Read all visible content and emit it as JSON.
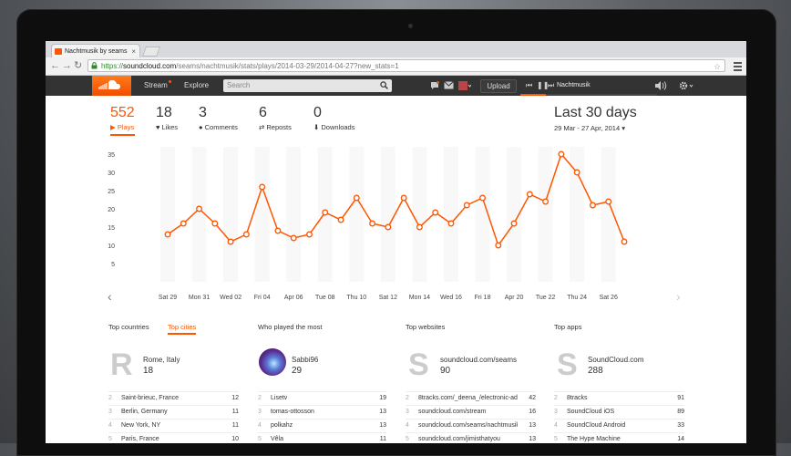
{
  "browser": {
    "tab_title": "Nachtmusik by seams",
    "url_scheme": "https://",
    "url_host": "soundcloud.com",
    "url_path": "/seams/nachtmusik/stats/plays/2014-03-29/2014-04-27?new_stats=1"
  },
  "header": {
    "nav": [
      "Stream",
      "Explore"
    ],
    "search_placeholder": "Search",
    "upload_label": "Upload",
    "now_playing": "Nachtmusik"
  },
  "stats": [
    {
      "value": "552",
      "label": "Plays"
    },
    {
      "value": "18",
      "label": "Likes"
    },
    {
      "value": "3",
      "label": "Comments"
    },
    {
      "value": "6",
      "label": "Reposts"
    },
    {
      "value": "0",
      "label": "Downloads"
    }
  ],
  "range": {
    "title": "Last 30 days",
    "dates": "29 Mar - 27 Apr, 2014"
  },
  "chart_data": {
    "type": "line",
    "x": [
      "Mar 29",
      "Mar 30",
      "Mar 31",
      "Apr 01",
      "Apr 02",
      "Apr 03",
      "Apr 04",
      "Apr 05",
      "Apr 06",
      "Apr 07",
      "Apr 08",
      "Apr 09",
      "Apr 10",
      "Apr 11",
      "Apr 12",
      "Apr 13",
      "Apr 14",
      "Apr 15",
      "Apr 16",
      "Apr 17",
      "Apr 18",
      "Apr 19",
      "Apr 20",
      "Apr 21",
      "Apr 22",
      "Apr 23",
      "Apr 24",
      "Apr 25",
      "Apr 26",
      "Apr 27"
    ],
    "values": [
      13,
      16,
      20,
      16,
      11,
      13,
      26,
      14,
      12,
      13,
      19,
      17,
      23,
      16,
      15,
      23,
      15,
      19,
      16,
      21,
      23,
      10,
      16,
      24,
      22,
      35,
      30,
      21,
      22,
      11
    ],
    "tick_labels": [
      "Sat 29",
      "Mon 31",
      "Wed 02",
      "Fri 04",
      "Apr 06",
      "Tue 08",
      "Thu 10",
      "Sat 12",
      "Mon 14",
      "Wed 16",
      "Fri 18",
      "Apr 20",
      "Tue 22",
      "Thu 24",
      "Sat 26"
    ],
    "yticks": [
      5,
      10,
      15,
      20,
      25,
      30,
      35
    ],
    "ylim": [
      0,
      37
    ],
    "color": "#ff5500",
    "grid": false
  },
  "panels": {
    "countries": {
      "tab1": "Top countries",
      "tab2": "Top cities",
      "top_letter": "R",
      "top_name": "Rome, Italy",
      "top_count": "18",
      "rows": [
        [
          "2",
          "Saint-brieuc, France",
          "12"
        ],
        [
          "3",
          "Berlin, Germany",
          "11"
        ],
        [
          "4",
          "New York, NY",
          "11"
        ],
        [
          "5",
          "Paris, France",
          "10"
        ]
      ]
    },
    "listeners": {
      "title": "Who played the most",
      "top_name": "Sabbi96",
      "top_count": "29",
      "rows": [
        [
          "2",
          "Lisetv",
          "19"
        ],
        [
          "3",
          "tomas-ottosson",
          "13"
        ],
        [
          "4",
          "polkahz",
          "13"
        ],
        [
          "5",
          "Vêla",
          "11"
        ]
      ]
    },
    "websites": {
      "title": "Top websites",
      "top_letter": "S",
      "top_name": "soundcloud.com/seams",
      "top_count": "90",
      "rows": [
        [
          "2",
          "8tracks.com/_deena_/electronic-ad",
          "42"
        ],
        [
          "3",
          "soundcloud.com/stream",
          "16"
        ],
        [
          "4",
          "soundcloud.com/seams/nachtmusik",
          "13"
        ],
        [
          "5",
          "soundcloud.com/jimisthatyou",
          "13"
        ]
      ]
    },
    "apps": {
      "title": "Top apps",
      "top_letter": "S",
      "top_name": "SoundCloud.com",
      "top_count": "288",
      "rows": [
        [
          "2",
          "8tracks",
          "91"
        ],
        [
          "3",
          "SoundCloud iOS",
          "89"
        ],
        [
          "4",
          "SoundCloud Android",
          "33"
        ],
        [
          "5",
          "The Hype Machine",
          "14"
        ]
      ]
    }
  }
}
